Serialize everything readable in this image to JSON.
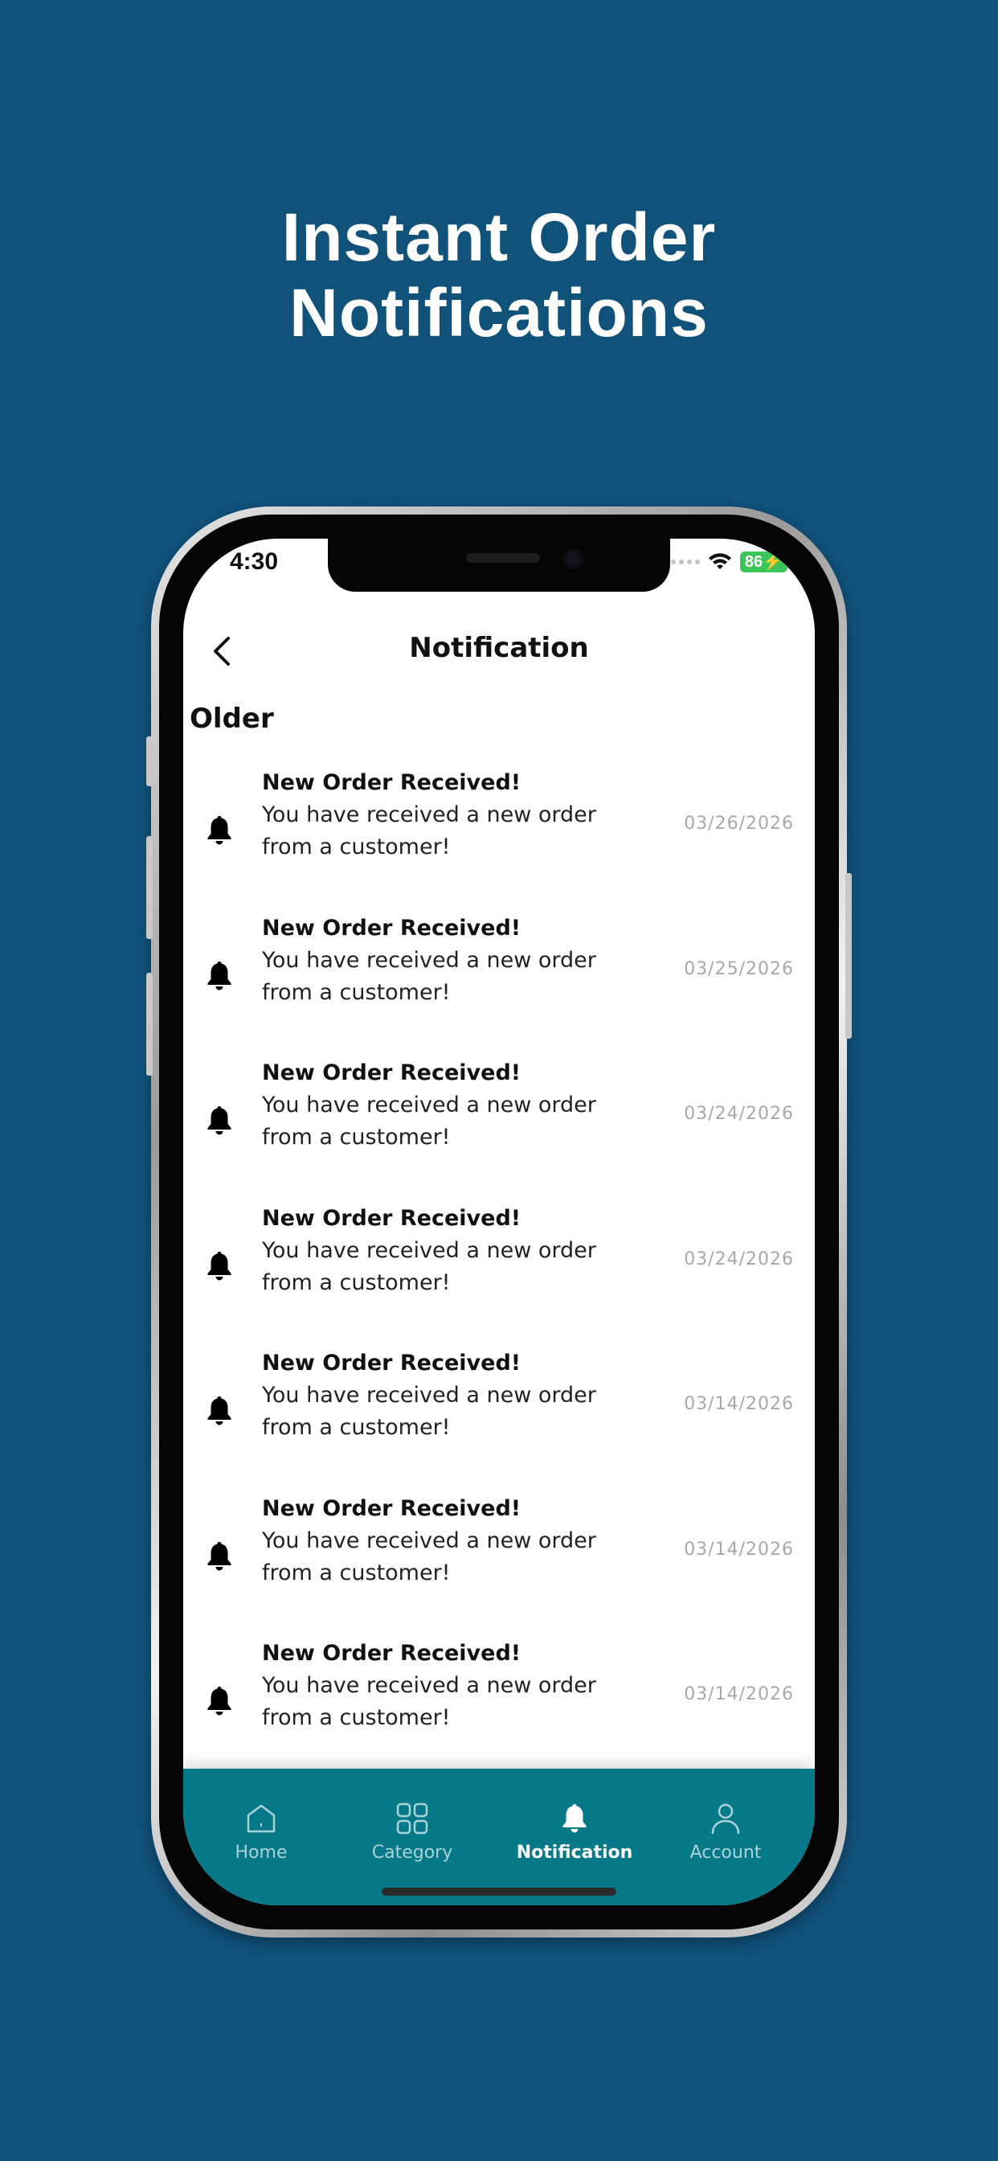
{
  "headline": {
    "line1": "Instant Order",
    "line2": "Notifications"
  },
  "status_bar": {
    "time": "4:30",
    "battery": "86"
  },
  "header": {
    "title": "Notification"
  },
  "section": {
    "label": "Older"
  },
  "notifications": [
    {
      "title": "New Order Received!",
      "body_line1": "You have received a new order",
      "body_line2": "from a customer!",
      "date": "03/26/2026"
    },
    {
      "title": "New Order Received!",
      "body_line1": "You have received a new order",
      "body_line2": "from a customer!",
      "date": "03/25/2026"
    },
    {
      "title": "New Order Received!",
      "body_line1": "You have received a new order",
      "body_line2": "from a customer!",
      "date": "03/24/2026"
    },
    {
      "title": "New Order Received!",
      "body_line1": "You have received a new order",
      "body_line2": "from a customer!",
      "date": "03/24/2026"
    },
    {
      "title": "New Order Received!",
      "body_line1": "You have received a new order",
      "body_line2": "from a customer!",
      "date": "03/14/2026"
    },
    {
      "title": "New Order Received!",
      "body_line1": "You have received a new order",
      "body_line2": "from a customer!",
      "date": "03/14/2026"
    },
    {
      "title": "New Order Received!",
      "body_line1": "You have received a new order",
      "body_line2": "from a customer!",
      "date": "03/14/2026"
    }
  ],
  "tabbar": {
    "items": [
      {
        "label": "Home",
        "icon": "home-icon"
      },
      {
        "label": "Category",
        "icon": "grid-icon"
      },
      {
        "label": "Notification",
        "icon": "bell-icon",
        "active": true
      },
      {
        "label": "Account",
        "icon": "user-icon"
      }
    ]
  },
  "colors": {
    "background": "#11527b",
    "tabbar": "#057988",
    "battery": "#3cc65a"
  }
}
